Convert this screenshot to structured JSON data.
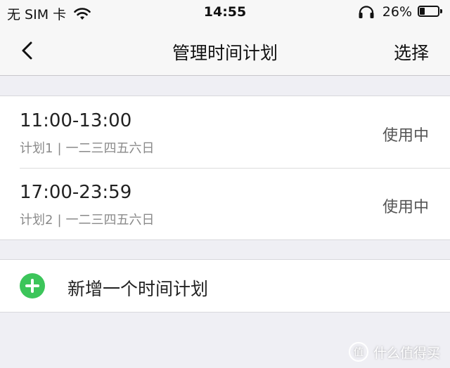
{
  "status_bar": {
    "carrier": "无 SIM 卡",
    "time": "14:55",
    "battery_percent": "26%",
    "battery_level": 0.26,
    "icons": [
      "wifi-icon",
      "headphones-icon",
      "battery-icon"
    ]
  },
  "nav": {
    "title": "管理时间计划",
    "action_label": "选择",
    "back_icon": "chevron-left-icon"
  },
  "plans": [
    {
      "time_range": "11:00-13:00",
      "name": "计划1",
      "separator": "|",
      "days": "一二三四五六日",
      "status": "使用中"
    },
    {
      "time_range": "17:00-23:59",
      "name": "计划2",
      "separator": "|",
      "days": "一二三四五六日",
      "status": "使用中"
    }
  ],
  "add_plan": {
    "label": "新增一个时间计划",
    "icon": "plus-circle-icon",
    "icon_color": "#3cc55a"
  },
  "watermark": {
    "text": "什么值得买",
    "icon": "zhi-logo-icon"
  },
  "colors": {
    "background": "#efeff4",
    "card": "#ffffff",
    "accent_green": "#3cc55a"
  }
}
